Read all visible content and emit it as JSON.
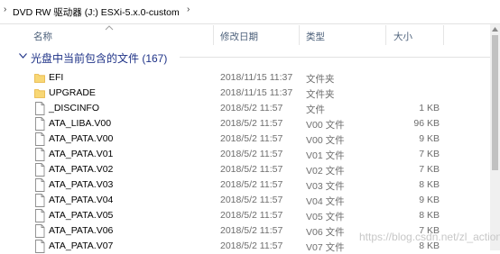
{
  "breadcrumb": {
    "segments": [
      "DVD RW 驱动器 (J:) ESXi-5.x.0-custom"
    ]
  },
  "columns": {
    "name": "名称",
    "date": "修改日期",
    "type": "类型",
    "size": "大小"
  },
  "group": {
    "label": "光盘中当前包含的文件 (167)"
  },
  "files": [
    {
      "name": "EFI",
      "date": "2018/11/15 11:37",
      "type": "文件夹",
      "size": "",
      "kind": "folder"
    },
    {
      "name": "UPGRADE",
      "date": "2018/11/15 11:37",
      "type": "文件夹",
      "size": "",
      "kind": "folder"
    },
    {
      "name": "_DISCINFO",
      "date": "2018/5/2 11:57",
      "type": "文件",
      "size": "1 KB",
      "kind": "file"
    },
    {
      "name": "ATA_LIBA.V00",
      "date": "2018/5/2 11:57",
      "type": "V00 文件",
      "size": "96 KB",
      "kind": "file"
    },
    {
      "name": "ATA_PATA.V00",
      "date": "2018/5/2 11:57",
      "type": "V00 文件",
      "size": "9 KB",
      "kind": "file"
    },
    {
      "name": "ATA_PATA.V01",
      "date": "2018/5/2 11:57",
      "type": "V01 文件",
      "size": "7 KB",
      "kind": "file"
    },
    {
      "name": "ATA_PATA.V02",
      "date": "2018/5/2 11:57",
      "type": "V02 文件",
      "size": "7 KB",
      "kind": "file"
    },
    {
      "name": "ATA_PATA.V03",
      "date": "2018/5/2 11:57",
      "type": "V03 文件",
      "size": "8 KB",
      "kind": "file"
    },
    {
      "name": "ATA_PATA.V04",
      "date": "2018/5/2 11:57",
      "type": "V04 文件",
      "size": "9 KB",
      "kind": "file"
    },
    {
      "name": "ATA_PATA.V05",
      "date": "2018/5/2 11:57",
      "type": "V05 文件",
      "size": "8 KB",
      "kind": "file"
    },
    {
      "name": "ATA_PATA.V06",
      "date": "2018/5/2 11:57",
      "type": "V06 文件",
      "size": "7 KB",
      "kind": "file"
    },
    {
      "name": "ATA_PATA.V07",
      "date": "2018/5/2 11:57",
      "type": "V07 文件",
      "size": "8 KB",
      "kind": "file"
    }
  ],
  "watermark": "https://blog.csdn.net/zl_action",
  "colors": {
    "header_text": "#4c607a",
    "group_text": "#1e3287",
    "folder": "#f8d775",
    "folder_dark": "#e6b440",
    "secondary_text": "#6d6d6d"
  }
}
